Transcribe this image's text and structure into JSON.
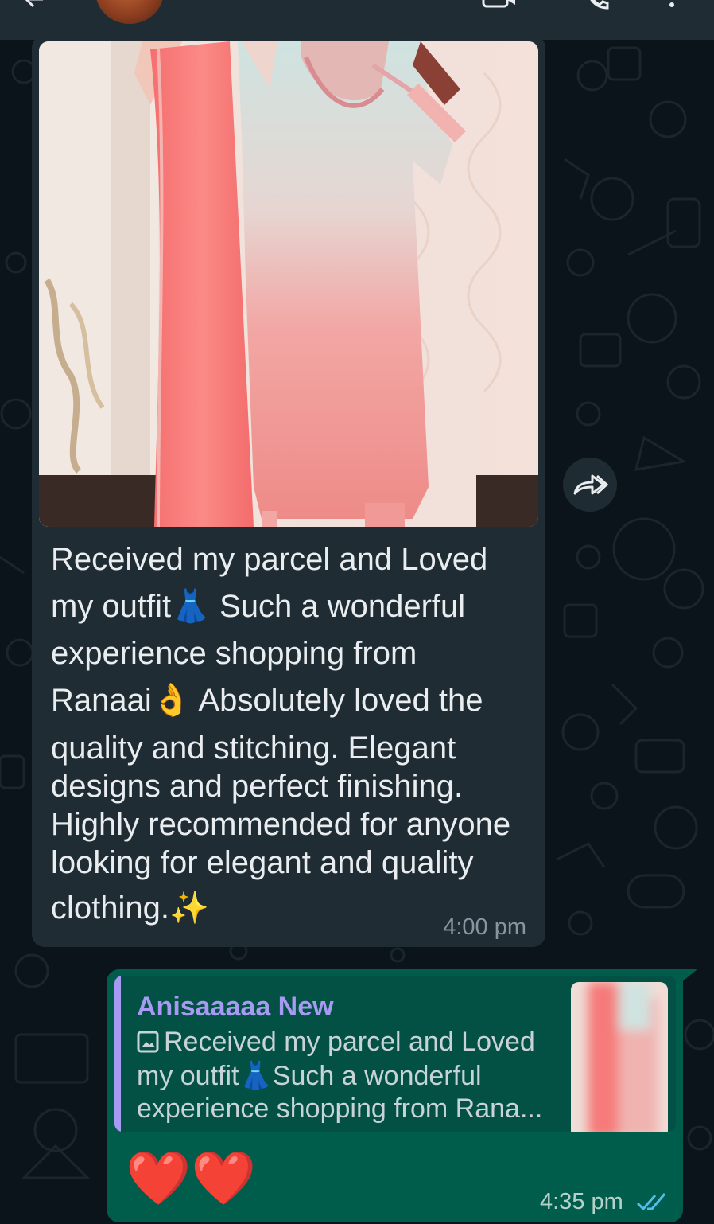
{
  "header": {
    "contact_name": "Anisaaaaa New"
  },
  "colors": {
    "chat_background": "#0b141a",
    "incoming_bubble": "#202c33",
    "outgoing_bubble": "#005c4b",
    "quote_accent": "#a79af3",
    "read_ticks": "#53bdeb"
  },
  "icons": [
    "back-arrow-icon",
    "video-call-icon",
    "phone-icon",
    "more-menu-icon",
    "forward-icon",
    "image-icon",
    "double-check-icon"
  ],
  "incoming_message": {
    "lines": [
      "Received my parcel and Loved",
      "my outfit👗 Such a wonderful",
      "experience shopping from",
      "Ranaai👌 Absolutely loved the",
      "quality and stitching. Elegant",
      "designs and perfect finishing.",
      "Highly recommended for anyone",
      "looking for elegant and quality",
      "clothing.✨"
    ],
    "time": "4:00 pm"
  },
  "outgoing_message": {
    "reply_to": {
      "author": "Anisaaaaa New",
      "line1": "Received my parcel and Loved",
      "line2": "my outfit👗Such a wonderful",
      "line3": "experience shopping from Rana..."
    },
    "text": "❤️❤️",
    "time": "4:35 pm",
    "status": "read"
  }
}
